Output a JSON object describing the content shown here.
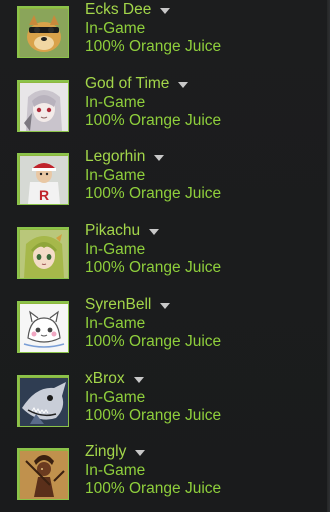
{
  "friends": [
    {
      "name": "Ecks Dee",
      "status": "In-Game",
      "game": "100% Orange Juice",
      "avatar_icon": "doge-avatar-icon"
    },
    {
      "name": "God of Time",
      "status": "In-Game",
      "game": "100% Orange Juice",
      "avatar_icon": "anime-white-hair-avatar-icon"
    },
    {
      "name": "Legorhin",
      "status": "In-Game",
      "game": "100% Orange Juice",
      "avatar_icon": "team-rocket-avatar-icon"
    },
    {
      "name": "Pikachu",
      "status": "In-Game",
      "game": "100% Orange Juice",
      "avatar_icon": "anime-green-hair-avatar-icon"
    },
    {
      "name": "SyrenBell",
      "status": "In-Game",
      "game": "100% Orange Juice",
      "avatar_icon": "sketch-cat-avatar-icon"
    },
    {
      "name": "xBrox",
      "status": "In-Game",
      "game": "100% Orange Juice",
      "avatar_icon": "shark-avatar-icon"
    },
    {
      "name": "Zingly",
      "status": "In-Game",
      "game": "100% Orange Juice",
      "avatar_icon": "warrior-avatar-icon"
    }
  ],
  "colors": {
    "background": "#1b1c1d",
    "name_text": "#a3d64a",
    "status_text": "#8fcf3c",
    "avatar_border": "#8bc34a",
    "caret": "#c8c8c8"
  }
}
